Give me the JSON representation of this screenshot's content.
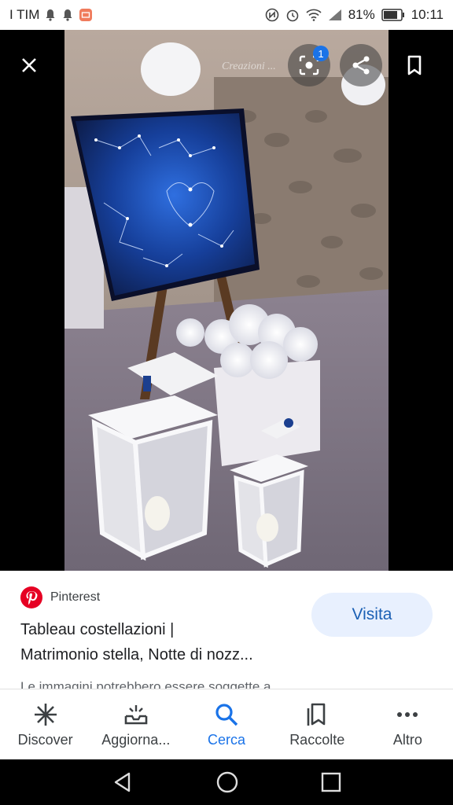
{
  "status_bar": {
    "carrier": "I TIM",
    "battery": "81%",
    "time": "10:11"
  },
  "viewer": {
    "close_icon": "close-icon",
    "lens_badge": "1",
    "photo_watermark": "Creazioni ... WEDDING & EVENT DESIGN"
  },
  "info": {
    "source": "Pinterest",
    "visit_label": "Visita",
    "title_line1": "Tableau costellazioni |",
    "title_line2": "Matrimonio stella, Notte di nozz...",
    "disclaimer": "Le immagini potrebbero essere soggette a..."
  },
  "bottom_nav": [
    {
      "label": "Discover",
      "icon": "asterisk-icon"
    },
    {
      "label": "Aggiorna...",
      "icon": "updates-icon"
    },
    {
      "label": "Cerca",
      "icon": "search-icon",
      "active": true
    },
    {
      "label": "Raccolte",
      "icon": "collections-icon"
    },
    {
      "label": "Altro",
      "icon": "more-icon"
    }
  ],
  "colors": {
    "accent": "#1a73e8",
    "pinterest": "#e60023"
  }
}
